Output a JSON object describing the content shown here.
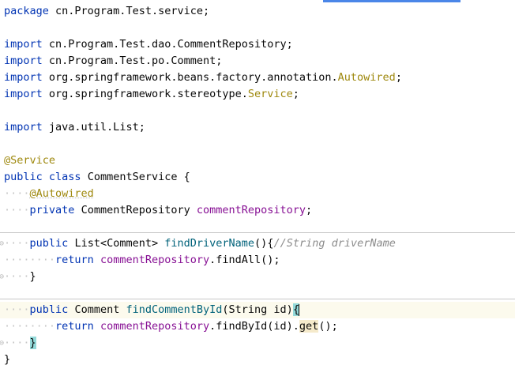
{
  "editor": {
    "lines": [
      {
        "kw": "package",
        "rest": " cn.Program.Test.service;"
      },
      {},
      {
        "kw": "import",
        "rest": " cn.Program.Test.dao.CommentRepository;"
      },
      {
        "kw": "import",
        "rest": " cn.Program.Test.po.Comment;"
      },
      {
        "kw": "import",
        "rest": " org.springframework.beans.factory.annotation.",
        "hl": "Autowired",
        "tail": ";"
      },
      {
        "kw": "import",
        "rest": " org.springframework.stereotype.",
        "hl": "Service",
        "tail": ";"
      },
      {},
      {
        "kw": "import",
        "rest": " java.util.List;"
      },
      {},
      {
        "ann": "@Service"
      },
      {
        "kw1": "public",
        "kw2": "class",
        "name": "CommentService",
        "tail": " {"
      },
      {
        "ws": "····",
        "ann": "@Autowired"
      },
      {
        "ws": "····",
        "kw": "private",
        "type": "CommentRepository",
        "field": "commentRepository",
        "tail": ";"
      },
      {},
      {
        "ws": "····",
        "kw": "public",
        "type": "List<Comment>",
        "method": "findDriverName",
        "sig": "(){",
        "comment": "//String driverName"
      },
      {
        "ws": "········",
        "kw": "return",
        "field": "commentRepository",
        "call": ".findAll();"
      },
      {
        "ws": "····",
        "brace": "}"
      },
      {},
      {
        "ws": "····",
        "kw": "public",
        "type": "Comment",
        "method": "findCommentById",
        "sig": "(String id)",
        "brace": "{"
      },
      {
        "ws": "········",
        "kw": "return",
        "field": "commentRepository",
        "call": ".findById(id).",
        "get": "get",
        "tail": "();"
      },
      {
        "ws": "····",
        "brace": "}"
      },
      {
        "brace": "}"
      }
    ]
  }
}
